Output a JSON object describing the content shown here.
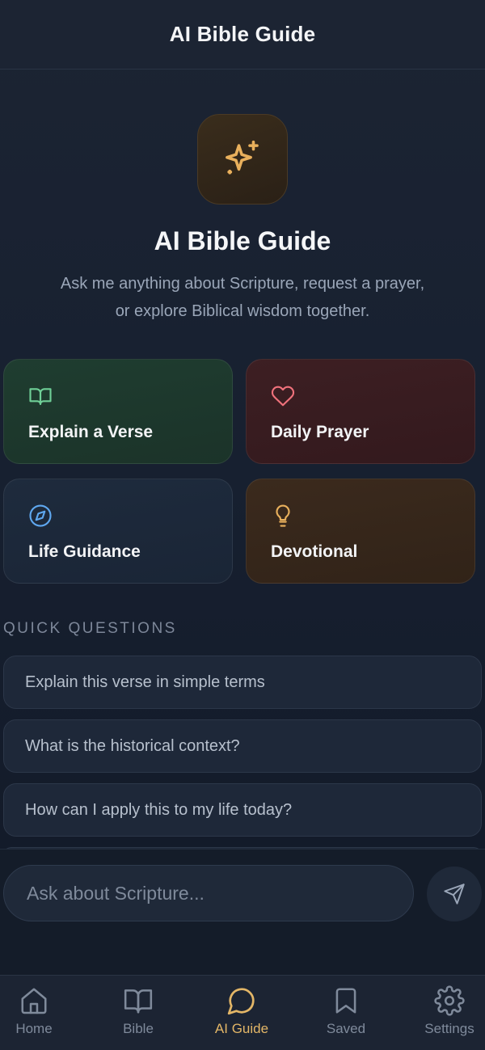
{
  "header": {
    "title": "AI Bible Guide"
  },
  "hero": {
    "icon": "sparkles-icon",
    "title": "AI Bible Guide",
    "subtitle_line1": "Ask me anything about Scripture, request a prayer,",
    "subtitle_line2": "or explore Biblical wisdom together."
  },
  "cards": [
    {
      "label": "Explain a Verse",
      "icon": "book-open-icon",
      "accent": "#6fcf97"
    },
    {
      "label": "Daily Prayer",
      "icon": "heart-icon",
      "accent": "#f0727c"
    },
    {
      "label": "Life Guidance",
      "icon": "compass-icon",
      "accent": "#5fa8f0"
    },
    {
      "label": "Devotional",
      "icon": "lightbulb-icon",
      "accent": "#e9b05c"
    }
  ],
  "quick_questions": {
    "heading": "QUICK QUESTIONS",
    "items": [
      "Explain this verse in simple terms",
      "What is the historical context?",
      "How can I apply this to my life today?"
    ]
  },
  "composer": {
    "placeholder": "Ask about Scripture...",
    "send_icon": "send-icon"
  },
  "tabbar": {
    "tabs": [
      {
        "label": "Home",
        "icon": "home-icon"
      },
      {
        "label": "Bible",
        "icon": "book-icon"
      },
      {
        "label": "AI Guide",
        "icon": "chat-bubble-icon",
        "active": true
      },
      {
        "label": "Saved",
        "icon": "bookmark-icon"
      },
      {
        "label": "Settings",
        "icon": "gear-icon"
      }
    ],
    "active_color": "#e3b667"
  }
}
